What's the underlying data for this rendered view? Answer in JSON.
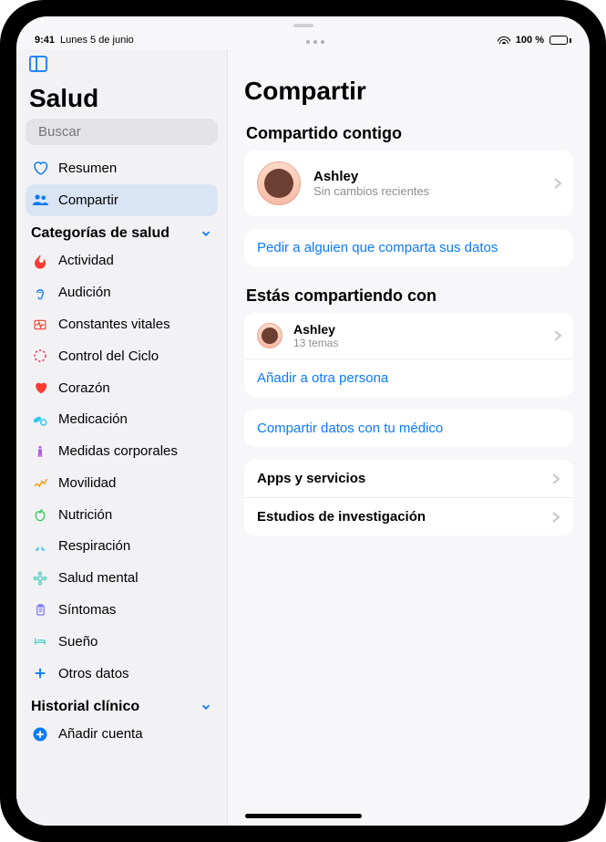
{
  "status": {
    "time": "9:41",
    "date": "Lunes 5 de junio",
    "battery": "100 %"
  },
  "sidebar": {
    "title": "Salud",
    "search_placeholder": "Buscar",
    "nav": [
      {
        "label": "Resumen",
        "icon": "heart-outline",
        "color": "#0a7aff"
      },
      {
        "label": "Compartir",
        "icon": "people",
        "color": "#0a7aff"
      }
    ],
    "sections": [
      {
        "title": "Categorías de salud",
        "items": [
          {
            "label": "Actividad",
            "icon": "flame",
            "color": "#ff3b30"
          },
          {
            "label": "Audición",
            "icon": "ear",
            "color": "#0a7aff"
          },
          {
            "label": "Constantes vitales",
            "icon": "ecg",
            "color": "#ff3b30"
          },
          {
            "label": "Control del Ciclo",
            "icon": "cycle",
            "color": "#ff2d55"
          },
          {
            "label": "Corazón",
            "icon": "heart",
            "color": "#ff3b30"
          },
          {
            "label": "Medicación",
            "icon": "pills",
            "color": "#34c7ef"
          },
          {
            "label": "Medidas corporales",
            "icon": "body",
            "color": "#af52de"
          },
          {
            "label": "Movilidad",
            "icon": "walk",
            "color": "#ff9500"
          },
          {
            "label": "Nutrición",
            "icon": "apple",
            "color": "#34c759"
          },
          {
            "label": "Respiración",
            "icon": "lungs",
            "color": "#5ac8fa"
          },
          {
            "label": "Salud mental",
            "icon": "mind",
            "color": "#5ed0c8"
          },
          {
            "label": "Síntomas",
            "icon": "clip",
            "color": "#7d7aff"
          },
          {
            "label": "Sueño",
            "icon": "bed",
            "color": "#2fccc0"
          },
          {
            "label": "Otros datos",
            "icon": "plus",
            "color": "#0a7aff"
          }
        ]
      },
      {
        "title": "Historial clínico",
        "items": [
          {
            "label": "Añadir cuenta",
            "icon": "plus-fill",
            "color": "#0a7aff"
          }
        ]
      }
    ]
  },
  "main": {
    "title": "Compartir",
    "shared_with_you": {
      "heading": "Compartido contigo",
      "contact": {
        "name": "Ashley",
        "sub": "Sin cambios recientes"
      },
      "ask_link": "Pedir a alguien que comparta sus datos"
    },
    "you_share_with": {
      "heading": "Estás compartiendo con",
      "contact": {
        "name": "Ashley",
        "sub": "13 temas"
      },
      "add_link": "Añadir a otra persona",
      "doctor_link": "Compartir datos con tu médico"
    },
    "more": {
      "apps": "Apps y servicios",
      "studies": "Estudios de investigación"
    }
  }
}
